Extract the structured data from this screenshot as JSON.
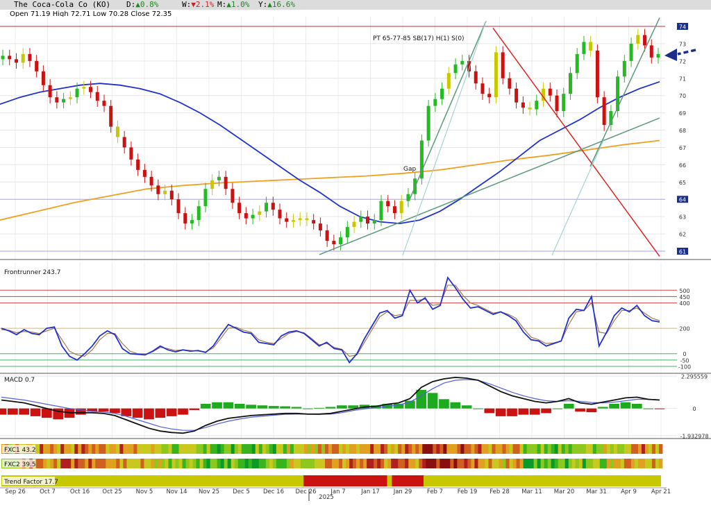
{
  "header": {
    "title": "The Coca-Cola Co (KO)",
    "changes": [
      {
        "label": "D:",
        "dir": "up",
        "value": "0.8%"
      },
      {
        "label": "W:",
        "dir": "down",
        "value": "2.1%"
      },
      {
        "label": "M:",
        "dir": "up",
        "value": "1.0%"
      },
      {
        "label": "Y:",
        "dir": "up",
        "value": "16.6%"
      }
    ],
    "ohlc": "Open 71.19  High 72.71  Low 70.28  Close 72.35"
  },
  "colors": {
    "up_candle": "#22bb22",
    "down_candle": "#cc1111",
    "neutral_candle": "#c8c800",
    "ma_fast": "#2030d0",
    "ma_slow": "#f0a020",
    "trend_red": "#e02020",
    "trend_green": "#5a9a7a",
    "pointer": "#1a2f8a"
  },
  "chart_data": [
    {
      "type": "candlestick",
      "name": "price",
      "ylim": [
        61,
        74
      ],
      "y_ticks": [
        "61",
        "62",
        "63",
        "64",
        "65",
        "66",
        "67",
        "68",
        "69",
        "70",
        "71",
        "72",
        "73",
        "74"
      ],
      "highlighted_levels": [
        "74",
        "64",
        "61"
      ],
      "annotations": [
        "PT 65-77-85 SB(17) H(1) S(0)",
        "Gap"
      ],
      "x_labels": [
        "Sep 26",
        "Oct 7",
        "Oct 16",
        "Oct 25",
        "Nov 5",
        "Nov 14",
        "Nov 25",
        "Dec 5",
        "Dec 16",
        "Dec 26",
        "Jan 7",
        "Jan 17",
        "Jan 29",
        "Feb 7",
        "Feb 19",
        "Feb 28",
        "Mar 11",
        "Mar 20",
        "Mar 31",
        "Apr 9",
        "Apr 21"
      ],
      "year_label": "2025",
      "close": [
        72.3,
        72.1,
        71.9,
        72.4,
        72.0,
        71.4,
        70.6,
        69.9,
        69.6,
        69.8,
        69.9,
        70.4,
        70.5,
        70.2,
        69.7,
        69.4,
        68.2,
        67.6,
        67.0,
        66.3,
        65.7,
        65.3,
        64.8,
        64.3,
        64.5,
        64.0,
        63.2,
        62.6,
        62.8,
        63.6,
        64.6,
        65.1,
        65.3,
        64.6,
        63.8,
        63.2,
        62.9,
        63.1,
        63.3,
        63.8,
        63.4,
        62.9,
        62.7,
        62.8,
        62.9,
        62.8,
        62.6,
        62.2,
        61.6,
        61.4,
        61.8,
        62.4,
        62.7,
        63.0,
        62.6,
        62.8,
        63.9,
        63.6,
        63.2,
        63.9,
        64.3,
        65.2,
        67.4,
        69.4,
        69.8,
        70.4,
        71.3,
        71.8,
        72.0,
        71.4,
        70.7,
        70.1,
        69.9,
        72.5,
        71.0,
        70.4,
        69.6,
        69.3,
        69.2,
        69.7,
        70.4,
        70.0,
        69.1,
        70.1,
        71.3,
        72.4,
        73.1,
        72.6,
        69.9,
        68.3,
        69.1,
        71.1,
        72.0,
        73.0,
        73.5,
        72.9,
        72.2,
        72.4
      ],
      "ma_fast": [
        69.5,
        69.9,
        70.2,
        70.4,
        70.6,
        70.7,
        70.6,
        70.4,
        70.1,
        69.6,
        69.0,
        68.3,
        67.5,
        66.7,
        65.9,
        65.1,
        64.4,
        63.6,
        63.0,
        62.7,
        62.6,
        62.8,
        63.3,
        64.0,
        64.8,
        65.6,
        66.5,
        67.4,
        68.0,
        68.6,
        69.3,
        69.9,
        70.4,
        70.8
      ],
      "ma_slow": [
        62.8,
        63.3,
        63.8,
        64.2,
        64.6,
        64.8,
        64.95,
        65.05,
        65.15,
        65.25,
        65.35,
        65.5,
        65.7,
        66.0,
        66.3,
        66.55,
        66.85,
        67.15,
        67.4
      ],
      "trendlines": [
        {
          "color": "red",
          "from": [
            "Mar 1",
            73.9
          ],
          "to": [
            "Apr 30",
            60.7
          ]
        },
        {
          "color": "green",
          "from": [
            "Jan 7",
            60.8
          ],
          "to": [
            "Apr 30",
            68.7
          ]
        },
        {
          "color": "green",
          "from": [
            "Feb 5",
            64.0
          ],
          "to": [
            "Feb 26",
            74.3
          ]
        },
        {
          "color": "green",
          "from": [
            "Apr 3",
            65.9
          ],
          "to": [
            "Apr 30",
            74.5
          ]
        }
      ]
    },
    {
      "type": "line",
      "name": "Frontrunner",
      "label": "Frontrunner 243.7",
      "levels": [
        "500",
        "450",
        "400",
        "200",
        "0",
        "-50",
        "-100"
      ],
      "series": [
        {
          "name": "fast",
          "values": [
            200,
            180,
            150,
            190,
            160,
            150,
            200,
            210,
            60,
            -20,
            -50,
            0,
            60,
            140,
            180,
            150,
            40,
            0,
            -5,
            -10,
            20,
            60,
            30,
            15,
            30,
            20,
            25,
            10,
            60,
            150,
            230,
            200,
            170,
            160,
            90,
            80,
            70,
            140,
            170,
            180,
            160,
            110,
            60,
            90,
            40,
            30,
            -70,
            0,
            120,
            220,
            320,
            340,
            280,
            300,
            500,
            400,
            440,
            350,
            380,
            600,
            520,
            430,
            360,
            370,
            340,
            310,
            330,
            300,
            260,
            170,
            110,
            100,
            60,
            80,
            100,
            280,
            350,
            340,
            450,
            60,
            170,
            300,
            360,
            330,
            380,
            300,
            260,
            250
          ]
        },
        {
          "name": "slow",
          "values": [
            190,
            185,
            165,
            175,
            170,
            160,
            180,
            200,
            110,
            20,
            -10,
            -20,
            30,
            110,
            160,
            160,
            80,
            20,
            0,
            -5,
            15,
            50,
            40,
            25,
            30,
            25,
            20,
            15,
            45,
            120,
            200,
            210,
            185,
            170,
            110,
            90,
            80,
            120,
            160,
            175,
            165,
            120,
            70,
            80,
            50,
            35,
            -20,
            -10,
            90,
            190,
            290,
            330,
            300,
            310,
            420,
            420,
            430,
            380,
            390,
            540,
            540,
            460,
            400,
            380,
            350,
            320,
            330,
            310,
            280,
            200,
            130,
            110,
            80,
            85,
            100,
            230,
            330,
            340,
            400,
            170,
            160,
            260,
            340,
            340,
            360,
            320,
            280,
            260
          ]
        }
      ]
    },
    {
      "type": "bar+line",
      "name": "MACD",
      "label": "MACD 0.7",
      "y_labels": [
        "2.295559",
        "0",
        "-1.932978"
      ],
      "series": [
        {
          "name": "macd",
          "values": [
            0.6,
            0.5,
            0.4,
            0.2,
            0.0,
            -0.2,
            -0.3,
            -0.3,
            -0.3,
            -0.35,
            -0.5,
            -0.8,
            -1.1,
            -1.4,
            -1.6,
            -1.7,
            -1.75,
            -1.6,
            -1.2,
            -0.9,
            -0.7,
            -0.6,
            -0.5,
            -0.45,
            -0.4,
            -0.35,
            -0.35,
            -0.4,
            -0.4,
            -0.35,
            -0.2,
            -0.05,
            0.1,
            0.15,
            0.3,
            0.4,
            0.7,
            1.5,
            1.9,
            2.1,
            2.2,
            2.15,
            2.0,
            1.6,
            1.2,
            0.9,
            0.7,
            0.5,
            0.4,
            0.5,
            0.7,
            0.4,
            0.3,
            0.45,
            0.6,
            0.75,
            0.8,
            0.65,
            0.6
          ]
        },
        {
          "name": "signal",
          "values": [
            0.8,
            0.7,
            0.6,
            0.45,
            0.3,
            0.15,
            0.0,
            -0.1,
            -0.2,
            -0.25,
            -0.35,
            -0.55,
            -0.8,
            -1.05,
            -1.3,
            -1.45,
            -1.55,
            -1.55,
            -1.35,
            -1.1,
            -0.9,
            -0.75,
            -0.62,
            -0.55,
            -0.48,
            -0.42,
            -0.4,
            -0.4,
            -0.42,
            -0.4,
            -0.3,
            -0.15,
            -0.02,
            0.05,
            0.15,
            0.25,
            0.45,
            0.9,
            1.4,
            1.8,
            2.0,
            2.05,
            2.0,
            1.75,
            1.45,
            1.15,
            0.9,
            0.7,
            0.55,
            0.5,
            0.55,
            0.5,
            0.42,
            0.4,
            0.45,
            0.55,
            0.65,
            0.65,
            0.62
          ]
        }
      ]
    },
    {
      "type": "heatmap",
      "name": "FXC1",
      "label": "FXC1 43.2"
    },
    {
      "type": "heatmap",
      "name": "FXC2",
      "label": "FXC2 39.5"
    },
    {
      "type": "band",
      "name": "Trend Factor",
      "label": "Trend Factor 17.7",
      "segments": [
        {
          "from": 0.0,
          "to": 0.458,
          "state": "neutral"
        },
        {
          "from": 0.458,
          "to": 0.585,
          "state": "bearish"
        },
        {
          "from": 0.585,
          "to": 0.592,
          "state": "neutral"
        },
        {
          "from": 0.592,
          "to": 0.64,
          "state": "bearish"
        },
        {
          "from": 0.64,
          "to": 1.0,
          "state": "neutral"
        }
      ]
    }
  ]
}
